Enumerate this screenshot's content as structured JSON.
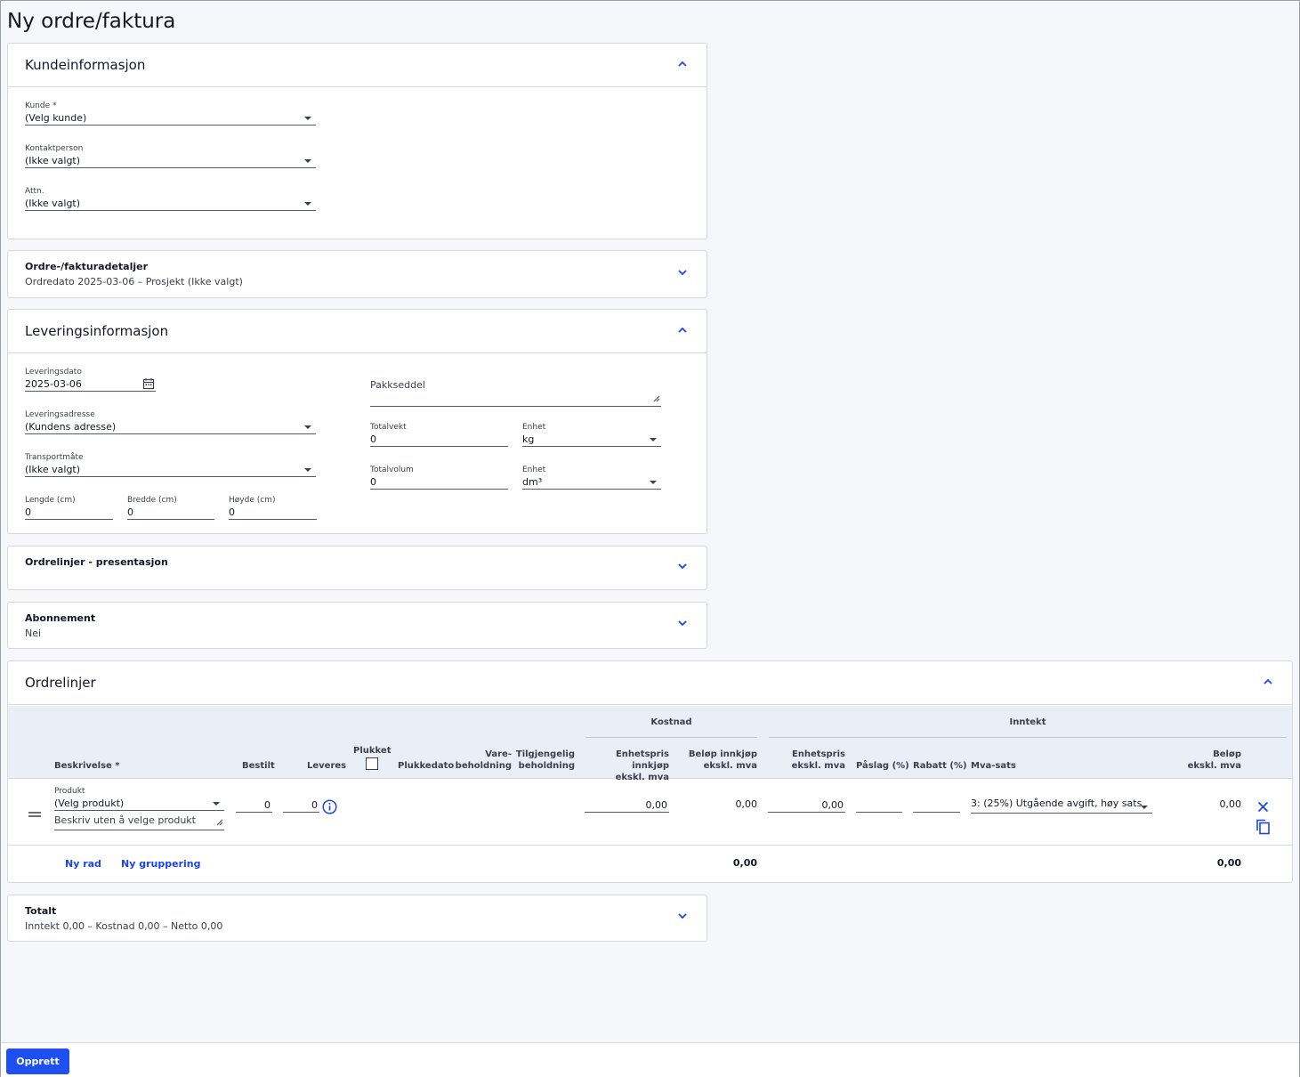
{
  "page": {
    "title": "Ny ordre/faktura"
  },
  "kunde": {
    "title": "Kundeinformasjon",
    "customer_label": "Kunde *",
    "customer_value": "(Velg kunde)",
    "contact_label": "Kontaktperson",
    "contact_value": "(Ikke valgt)",
    "attn_label": "Attn.",
    "attn_value": "(Ikke valgt)"
  },
  "details": {
    "title": "Ordre-/fakturadetaljer",
    "summary": "Ordredato 2025-03-06  –  Prosjekt (Ikke valgt)"
  },
  "levering": {
    "title": "Leveringsinformasjon",
    "date_label": "Leveringsdato",
    "date_value": "2025-03-06",
    "address_label": "Leveringsadresse",
    "address_value": "(Kundens adresse)",
    "transport_label": "Transportmåte",
    "transport_value": "(Ikke valgt)",
    "length_label": "Lengde (cm)",
    "length_value": "0",
    "width_label": "Bredde (cm)",
    "width_value": "0",
    "height_label": "Høyde (cm)",
    "height_value": "0",
    "packing_label": "Pakkseddel",
    "weight_label": "Totalvekt",
    "weight_value": "0",
    "weight_unit_label": "Enhet",
    "weight_unit_value": "kg",
    "volume_label": "Totalvolum",
    "volume_value": "0",
    "volume_unit_label": "Enhet",
    "volume_unit_value": "dm³"
  },
  "presentasjon": {
    "title": "Ordrelinjer - presentasjon"
  },
  "abonnement": {
    "title": "Abonnement",
    "value": "Nei"
  },
  "ordrelinjer": {
    "title": "Ordrelinjer",
    "group_cost": "Kostnad",
    "group_income": "Inntekt",
    "col_beskrivelse": "Beskrivelse *",
    "col_bestilt": "Bestilt",
    "col_leveres": "Leveres",
    "col_plukket": "Plukket",
    "col_plukkedato": "Plukkedato",
    "col_vare_1": "Vare-",
    "col_vare_2": "beholdning",
    "col_tilgj_1": "Tilgjengelig",
    "col_tilgj_2": "beholdning",
    "col_enh_innkjop_1": "Enhetspris innkjøp",
    "col_enh_innkjop_2": "ekskl. mva",
    "col_belop_innkjop_1": "Beløp innkjøp",
    "col_belop_innkjop_2": "ekskl. mva",
    "col_enhetspris_1": "Enhetspris",
    "col_enhetspris_2": "ekskl. mva",
    "col_paslag": "Påslag (%)",
    "col_rabatt": "Rabatt (%)",
    "col_mva": "Mva-sats",
    "col_belop_1": "Beløp",
    "col_belop_2": "ekskl. mva",
    "row": {
      "product_label": "Produkt",
      "product_value": "(Velg produkt)",
      "description_placeholder": "Beskriv uten å velge produkt",
      "bestilt": "0",
      "leveres": "0",
      "enh_innkjop": "0,00",
      "belop_innkjop": "0,00",
      "enhetspris": "0,00",
      "mva": "3: (25%) Utgående avgift, høy sats",
      "belop": "0,00"
    },
    "new_row": "Ny rad",
    "new_group": "Ny gruppering",
    "total_cost": "0,00",
    "total_income": "0,00"
  },
  "totalt": {
    "title": "Totalt",
    "summary": "Inntekt 0,00  –  Kostnad 0,00  –  Netto 0,00"
  },
  "footer": {
    "create_label": "Opprett"
  },
  "colors": {
    "accent": "#1f4ff0",
    "link": "#1a47e6"
  }
}
